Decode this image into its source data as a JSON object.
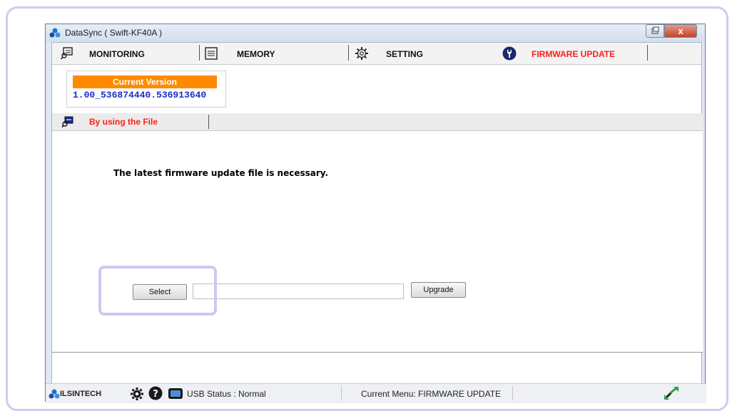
{
  "window": {
    "title": "DataSync ( Swift-KF40A )",
    "close_glyph": "x",
    "minimize_icon": "restore-icon"
  },
  "tabs": [
    {
      "label": "MONITORING",
      "icon": "monitoring-icon",
      "active": false
    },
    {
      "label": "MEMORY",
      "icon": "memory-icon",
      "active": false
    },
    {
      "label": "SETTING",
      "icon": "gear-icon",
      "active": false
    },
    {
      "label": "FIRMWARE UPDATE",
      "icon": "wrench-icon",
      "active": true
    }
  ],
  "version": {
    "header": "Current Version",
    "value": "1.00_536874440.536913640"
  },
  "subtab": {
    "label": "By using the File",
    "icon": "file-device-icon"
  },
  "panel": {
    "message": "The latest firmware update file is necessary.",
    "select_label": "Select",
    "file_path": "",
    "upgrade_label": "Upgrade"
  },
  "statusbar": {
    "brand": "ILSINTECH",
    "usb_status": "USB Status : Normal",
    "current_menu": "Current Menu: FIRMWARE UPDATE"
  },
  "colors": {
    "accent_orange": "#ff8a00",
    "active_tab_red": "#ff1d1d",
    "version_blue": "#1d2cc7",
    "highlight_lavender": "#c9caf0"
  }
}
